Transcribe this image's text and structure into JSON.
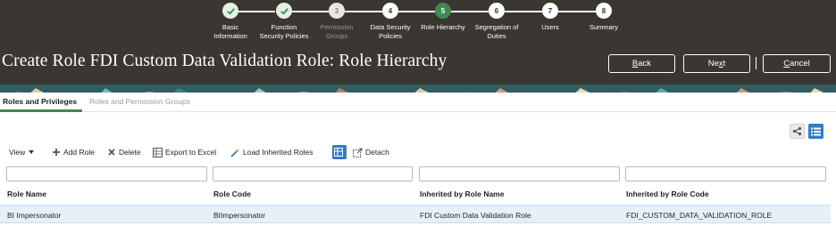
{
  "train": {
    "steps": [
      {
        "num": "1",
        "label_lines": [
          "Basic",
          "Information"
        ],
        "state": "done"
      },
      {
        "num": "2",
        "label_lines": [
          "Function",
          "Security Policies"
        ],
        "state": "done"
      },
      {
        "num": "3",
        "label_lines": [
          "Permission",
          "Groups"
        ],
        "state": "disabled"
      },
      {
        "num": "4",
        "label_lines": [
          "Data Security",
          "Policies"
        ],
        "state": "default"
      },
      {
        "num": "5",
        "label_lines": [
          "Role Hierarchy",
          ""
        ],
        "state": "current"
      },
      {
        "num": "6",
        "label_lines": [
          "Segregation of",
          "Duties"
        ],
        "state": "default"
      },
      {
        "num": "7",
        "label_lines": [
          "Users",
          ""
        ],
        "state": "default"
      },
      {
        "num": "8",
        "label_lines": [
          "Summary",
          ""
        ],
        "state": "default"
      }
    ]
  },
  "header": {
    "title": "Create Role FDI Custom Data Validation Role: Role Hierarchy",
    "back_prefix": "",
    "back_mnemonic": "B",
    "back_rest": "ack",
    "next_prefix": "Ne",
    "next_mnemonic": "x",
    "next_rest": "t",
    "cancel_prefix": "",
    "cancel_mnemonic": "C",
    "cancel_rest": "ancel"
  },
  "tabs": {
    "active": "Roles and Privileges",
    "inactive": "Roles and Permission Groups"
  },
  "toolbar": {
    "view": "View",
    "add_role": "Add Role",
    "delete": "Delete",
    "export": "Export to Excel",
    "load_inherited": "Load Inherited Roles",
    "detach": "Detach"
  },
  "table": {
    "columns": [
      "Role Name",
      "Role Code",
      "Inherited by Role Name",
      "Inherited by Role Code"
    ],
    "rows": [
      [
        "BI Impersonator",
        "BIImpersonator",
        "FDI Custom Data Validation Role",
        "FDI_CUSTOM_DATA_VALIDATION_ROLE"
      ]
    ]
  },
  "colors": {
    "header_bg": "#3a3632",
    "accent_green": "#3d8b50",
    "selected_blue": "#2f7bc8",
    "row_highlight": "#e6f0f8"
  },
  "icons": {
    "done_step": "checkmark-icon",
    "view_menu": "caret-down-icon",
    "add_role": "plus-icon",
    "delete": "x-icon",
    "export": "spreadsheet-icon",
    "load_inherited": "magic-wand-icon",
    "freeze": "freeze-column-icon",
    "detach": "detach-icon",
    "graph_view": "hierarchy-graph-icon",
    "list_view": "list-icon"
  }
}
